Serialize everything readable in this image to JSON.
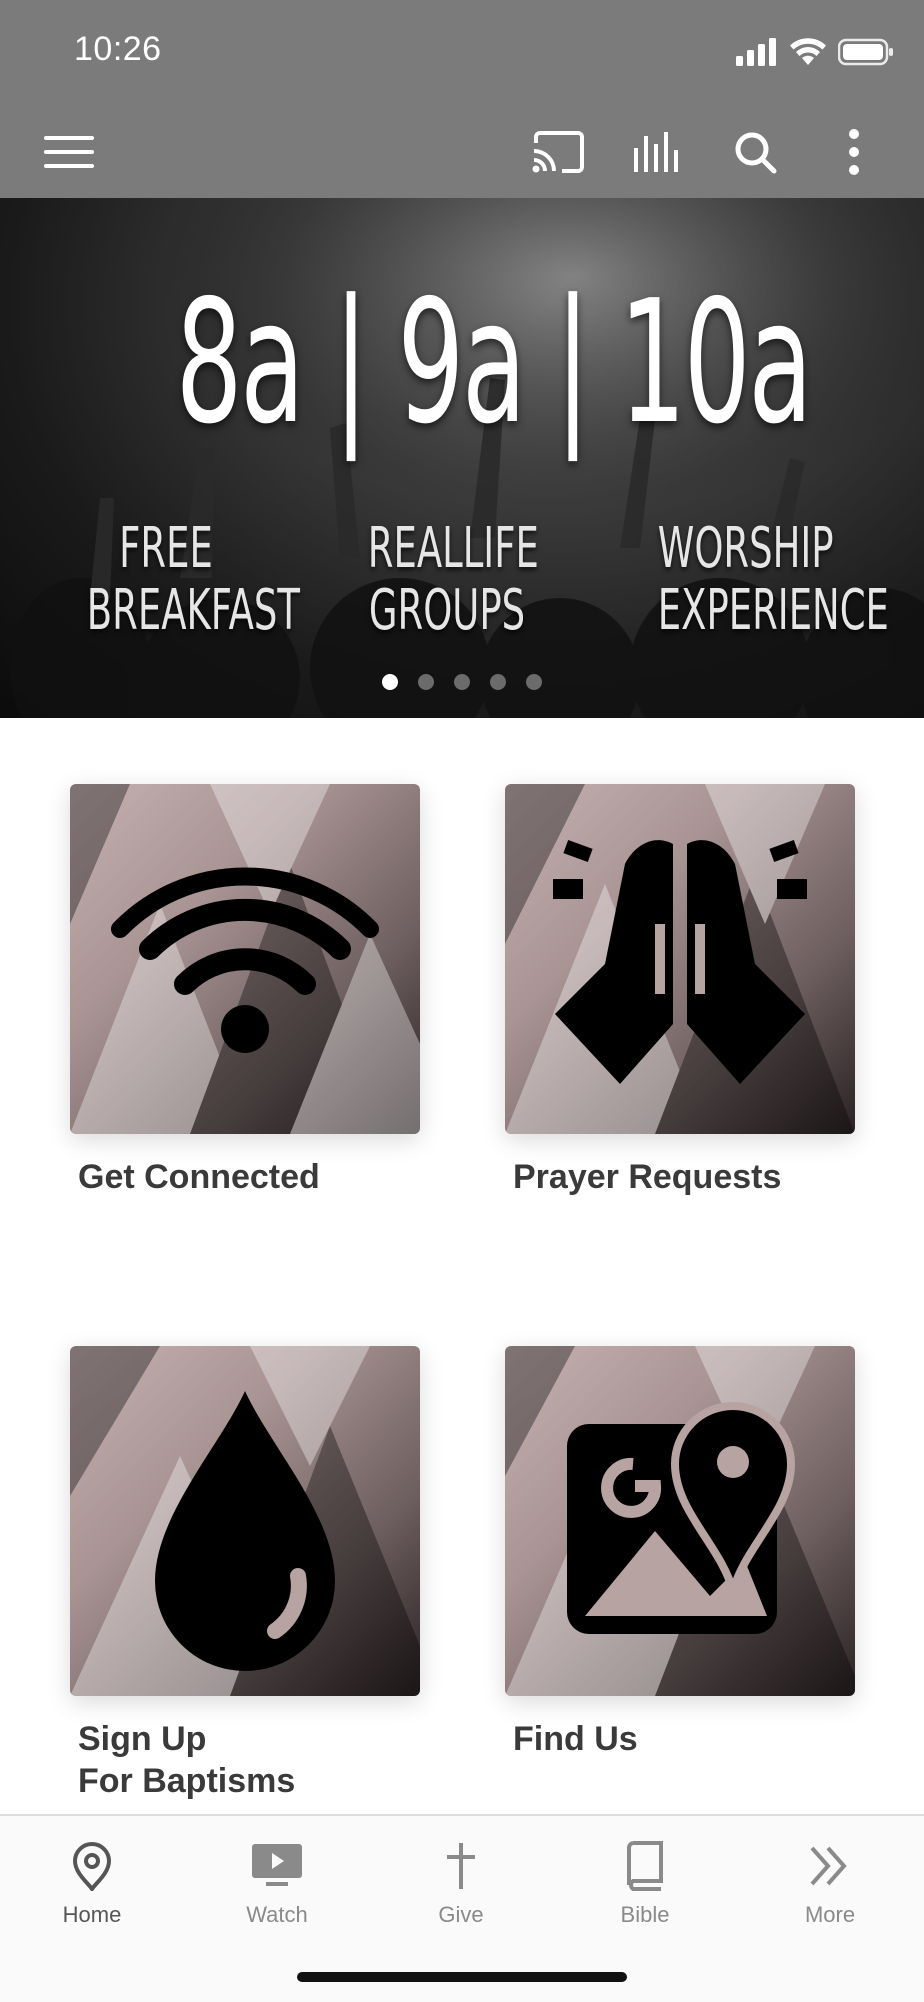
{
  "status_bar": {
    "time": "10:26"
  },
  "toolbar": {
    "icons": [
      "menu-icon",
      "cast-icon",
      "audio-bars-icon",
      "search-icon",
      "more-vertical-icon"
    ]
  },
  "hero": {
    "times": "8a | 9a | 10a",
    "columns": [
      {
        "line1": "FREE",
        "line2": "BREAKFAST"
      },
      {
        "line1": "REALLIFE",
        "line2": "GROUPS"
      },
      {
        "line1": "WORSHIP",
        "line2": "EXPERIENCE"
      }
    ],
    "carousel": {
      "count": 5,
      "active": 1
    }
  },
  "tiles": [
    {
      "label": "Get Connected",
      "icon": "wifi-icon"
    },
    {
      "label": "Prayer Requests",
      "icon": "praying-hands-icon"
    },
    {
      "label": "Sign Up\nFor Baptisms",
      "icon": "water-drop-icon"
    },
    {
      "label": "Find Us",
      "icon": "map-pin-icon"
    }
  ],
  "bottom_nav": [
    {
      "label": "Home",
      "icon": "map-pin-outline-icon",
      "active": true
    },
    {
      "label": "Watch",
      "icon": "tv-play-icon",
      "active": false
    },
    {
      "label": "Give",
      "icon": "cross-icon",
      "active": false
    },
    {
      "label": "Bible",
      "icon": "book-icon",
      "active": false
    },
    {
      "label": "More",
      "icon": "double-chevron-right-icon",
      "active": false
    }
  ],
  "colors": {
    "toolbar": "#7b7b7b",
    "tile_tint": "#b8a3a3",
    "label": "#3a3a3a",
    "nav_inactive": "#8a8a8a"
  }
}
